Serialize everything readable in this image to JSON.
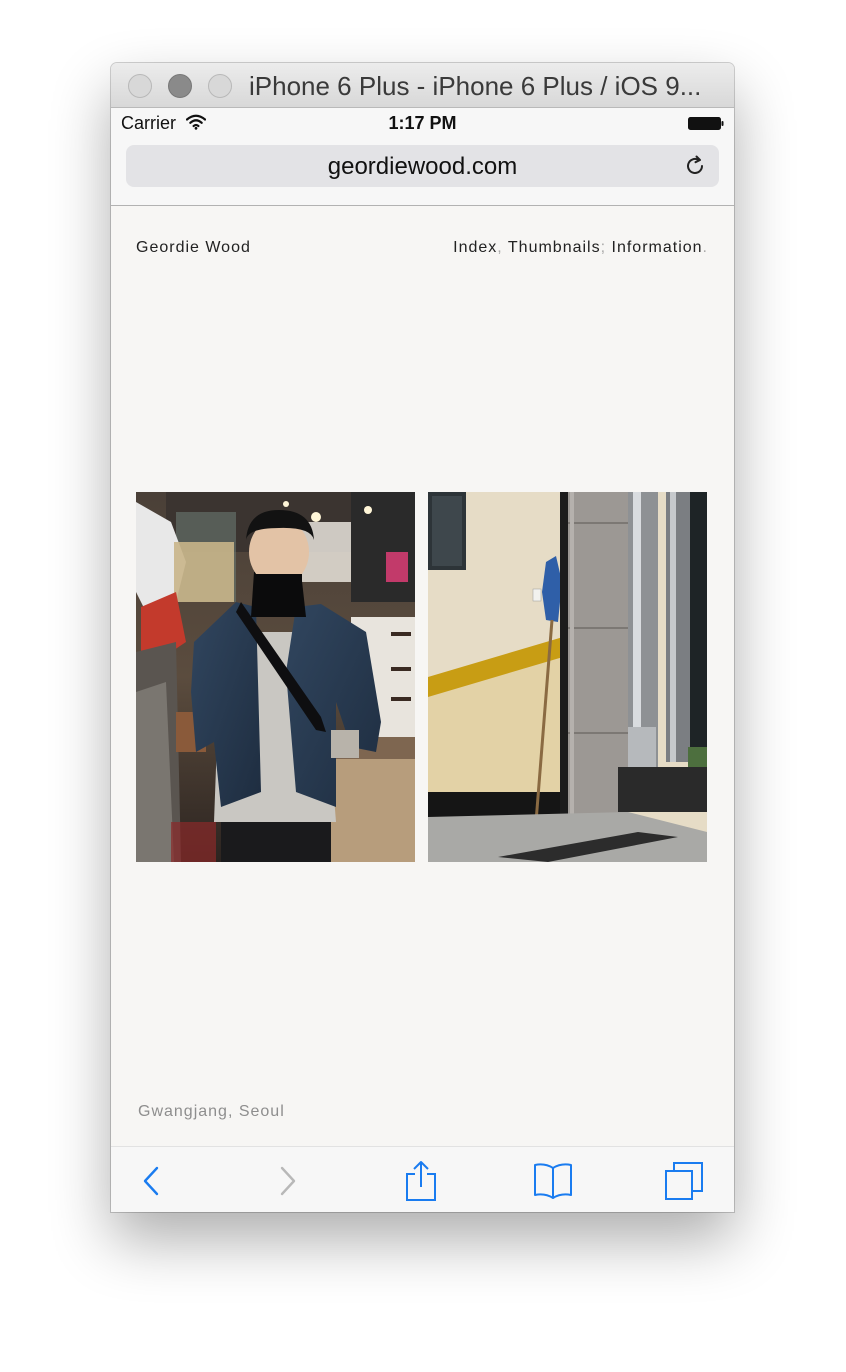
{
  "window": {
    "title": "iPhone 6 Plus - iPhone 6 Plus / iOS 9..."
  },
  "statusbar": {
    "carrier": "Carrier",
    "time": "1:17 PM"
  },
  "urlbar": {
    "url": "geordiewood.com"
  },
  "site": {
    "name": "Geordie Wood",
    "nav": [
      {
        "label": "Index",
        "sep": ","
      },
      {
        "label": "Thumbnails",
        "sep": ";"
      },
      {
        "label": "Information",
        "sep": "."
      }
    ],
    "caption": "Gwangjang, Seoul"
  },
  "icons": {
    "back": "chevron-left-icon",
    "forward": "chevron-right-icon",
    "share": "share-icon",
    "bookmarks": "book-icon",
    "tabs": "tabs-icon",
    "reload": "reload-icon"
  },
  "colors": {
    "ios_tint": "#1a7cf0",
    "disabled": "#b8b8b8",
    "page_bg": "#f7f6f4"
  }
}
